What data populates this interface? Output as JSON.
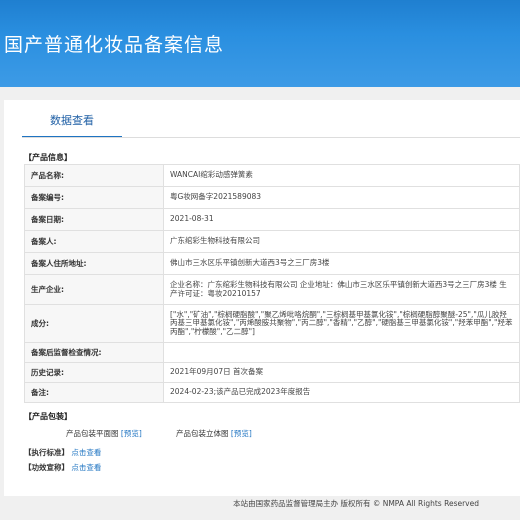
{
  "header": {
    "title": "国产普通化妆品备案信息"
  },
  "tab": {
    "label": "数据查看"
  },
  "product_info": {
    "section_label": "【产品信息】",
    "rows": [
      {
        "key": "产品名称:",
        "value": "WANCAI绾彩动感弹簧素"
      },
      {
        "key": "备案编号:",
        "value": "粤G妆网备字2021589083"
      },
      {
        "key": "备案日期:",
        "value": "2021-08-31"
      },
      {
        "key": "备案人:",
        "value": "广东绾彩生物科技有限公司"
      },
      {
        "key": "备案人住所地址:",
        "value": "佛山市三水区乐平镇创新大道西3号之三厂房3楼"
      },
      {
        "key": "生产企业:",
        "value": "企业名称：广东绾彩生物科技有限公司 企业地址：佛山市三水区乐平镇创新大道西3号之三厂房3楼 生产许可证：粤妆20210157"
      },
      {
        "key": "成分:",
        "value": "[\"水\",\"矿油\",\"棕榈硬脂酸\",\"聚乙烯吡咯烷酮\",\"三棕榈基甲基氯化铵\",\"棕榈硬脂醇聚醚-25\",\"瓜儿胶羟丙基三甲基氯化铵\",\"丙烯酸胺共聚物\",\"丙二醇\",\"香精\",\"乙醇\",\"硬脂基三甲基氯化铵\",\"羟苯甲酯\",\"羟苯丙酯\",\"柠檬酸\",\"乙二醇\"]"
      },
      {
        "key": "备案后监督检查情况:",
        "value": ""
      },
      {
        "key": "历史记录:",
        "value": "2021年09月07日 首次备案"
      },
      {
        "key": "备注:",
        "value": "2024-02-23;该产品已完成2023年度报告"
      }
    ]
  },
  "packaging": {
    "section_label": "【产品包装】",
    "item1_label": "产品包装平面图",
    "item1_link": "[预览]",
    "item2_label": "产品包装立体图",
    "item2_link": "[预览]"
  },
  "standard": {
    "section_label": "【执行标准】",
    "link": "点击查看"
  },
  "claims": {
    "section_label": "【功效宣称】",
    "link": "点击查看"
  },
  "footer": {
    "text": "本站由国家药品监督管理局主办 版权所有 © NMPA All Rights Reserved"
  }
}
